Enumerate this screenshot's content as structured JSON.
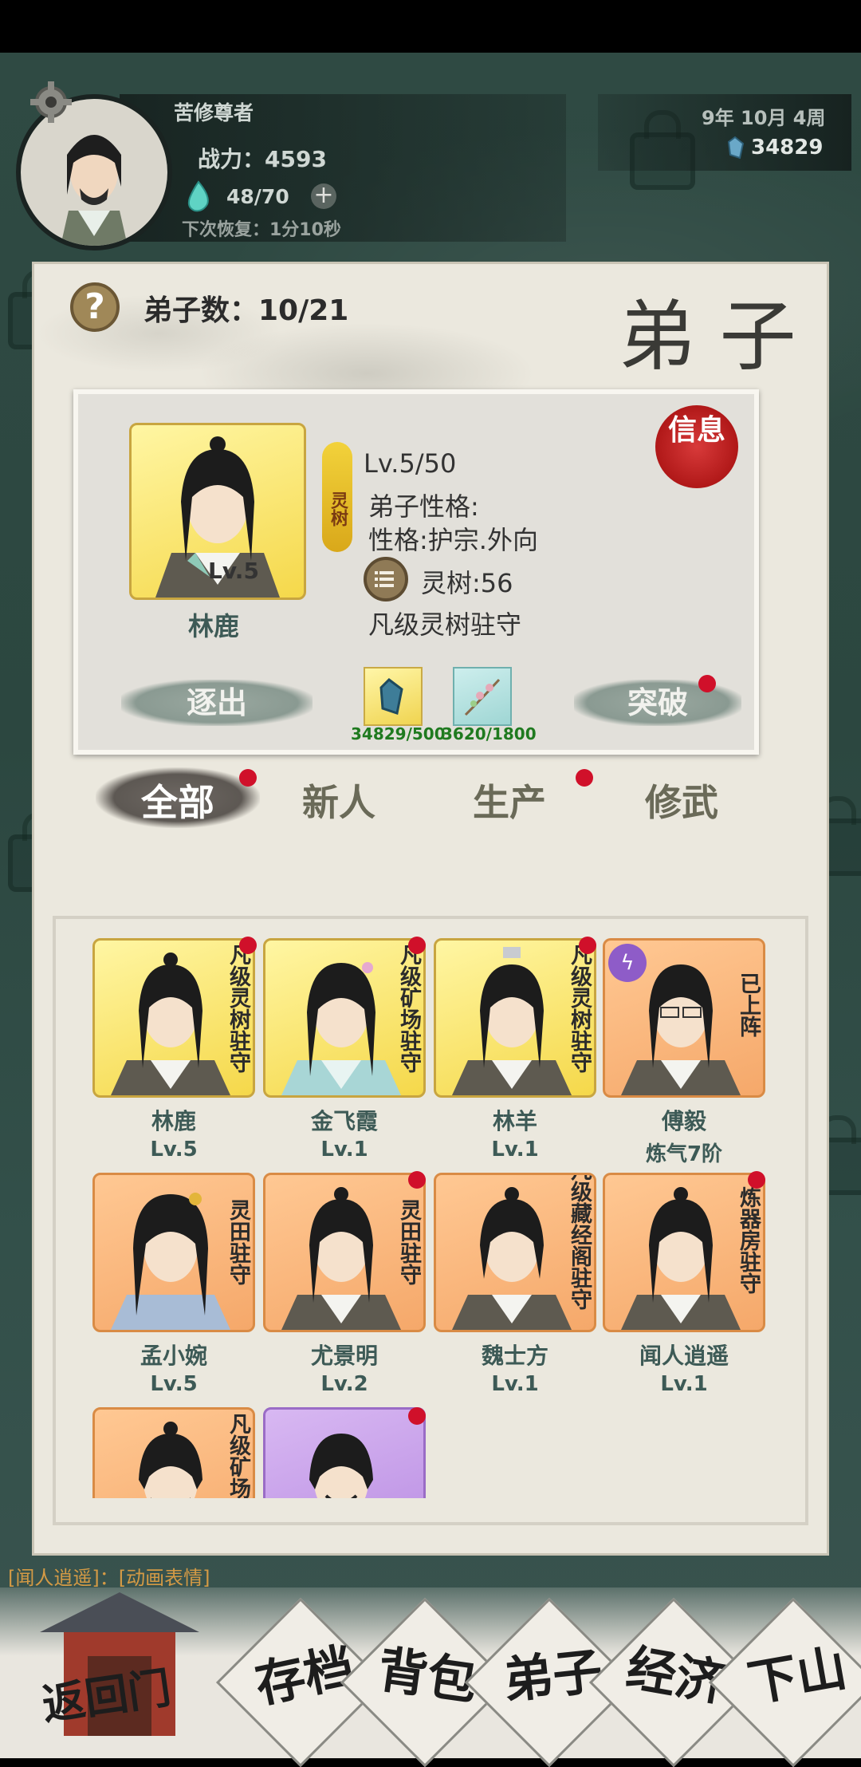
{
  "header": {
    "title": "苦修尊者",
    "power_label": "战力：4593",
    "stamina": "48/70",
    "recovery": "下次恢复：1分10秒",
    "date": "9年 10月  4周",
    "currency": "34829"
  },
  "panel": {
    "title": "弟 子",
    "disciple_count": "弟子数：10/21"
  },
  "selected": {
    "name": "林鹿",
    "level_badge": "Lv.5",
    "tag": "灵树",
    "level": "Lv.5/50",
    "personality_label": "弟子性格:",
    "personality": "性格:护宗.外向",
    "skill": "灵树:56",
    "post": "凡级灵树驻守",
    "stamp": "信息",
    "expel": "逐出",
    "breakthrough": "突破",
    "res1": "34829/500",
    "res2": "3620/1800"
  },
  "tabs": [
    {
      "label": "全部"
    },
    {
      "label": "新人"
    },
    {
      "label": "生产"
    },
    {
      "label": "修武"
    }
  ],
  "disciples": [
    {
      "name": "林鹿",
      "level": "Lv.5",
      "status": "凡级灵树驻守"
    },
    {
      "name": "金飞霞",
      "level": "Lv.1",
      "status": "凡级矿场驻守"
    },
    {
      "name": "林羊",
      "level": "Lv.1",
      "status": "凡级灵树驻守"
    },
    {
      "name": "傅毅",
      "level": "炼气7阶",
      "status": "已上阵"
    },
    {
      "name": "孟小婉",
      "level": "Lv.5",
      "status": "灵田驻守"
    },
    {
      "name": "尤景明",
      "level": "Lv.2",
      "status": "灵田驻守"
    },
    {
      "name": "魏士方",
      "level": "Lv.1",
      "status": "凡级藏经阁驻守"
    },
    {
      "name": "闻人逍遥",
      "level": "Lv.1",
      "status": "炼器房驻守"
    },
    {
      "name": "",
      "level": "",
      "status": "凡级矿场"
    },
    {
      "name": "",
      "level": "",
      "status": ""
    }
  ],
  "chat": {
    "line": "[闻人逍遥]：[动画表情]"
  },
  "nav": [
    {
      "label": "返回门"
    },
    {
      "label": "存档"
    },
    {
      "label": "背包"
    },
    {
      "label": "弟子"
    },
    {
      "label": "经济"
    },
    {
      "label": "下山"
    }
  ]
}
